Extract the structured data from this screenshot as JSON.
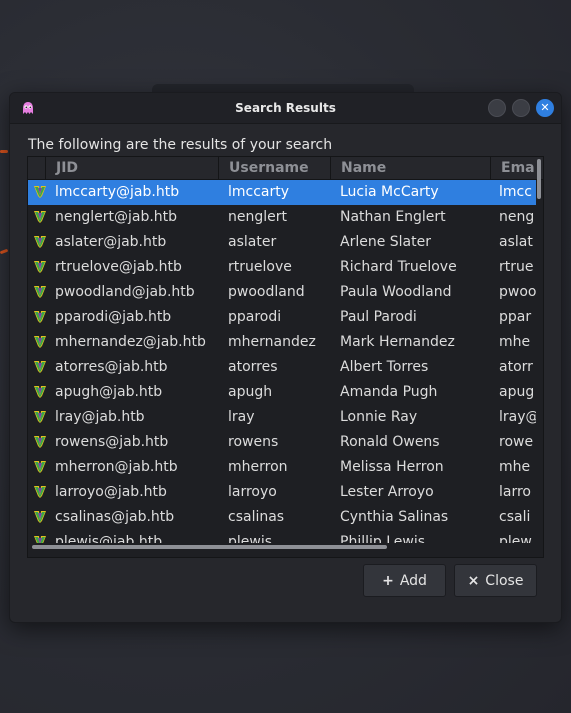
{
  "dialog": {
    "title": "Search Results",
    "description": "The following are the results of your search",
    "close_glyph": "✕"
  },
  "table": {
    "columns": [
      "JID",
      "Username",
      "Name",
      "Ema"
    ],
    "rows": [
      {
        "jid": "lmccarty@jab.htb",
        "username": "lmccarty",
        "name": "Lucia McCarty",
        "email": "lmcc"
      },
      {
        "jid": "nenglert@jab.htb",
        "username": "nenglert",
        "name": "Nathan Englert",
        "email": "neng"
      },
      {
        "jid": "aslater@jab.htb",
        "username": "aslater",
        "name": "Arlene Slater",
        "email": "aslat"
      },
      {
        "jid": "rtruelove@jab.htb",
        "username": "rtruelove",
        "name": "Richard Truelove",
        "email": "rtrue"
      },
      {
        "jid": "pwoodland@jab.htb",
        "username": "pwoodland",
        "name": "Paula Woodland",
        "email": "pwoo"
      },
      {
        "jid": "pparodi@jab.htb",
        "username": "pparodi",
        "name": "Paul Parodi",
        "email": "ppar"
      },
      {
        "jid": "mhernandez@jab.htb",
        "username": "mhernandez",
        "name": "Mark Hernandez",
        "email": "mhe"
      },
      {
        "jid": "atorres@jab.htb",
        "username": "atorres",
        "name": "Albert Torres",
        "email": "atorr"
      },
      {
        "jid": "apugh@jab.htb",
        "username": "apugh",
        "name": "Amanda Pugh",
        "email": "apug"
      },
      {
        "jid": "lray@jab.htb",
        "username": "lray",
        "name": "Lonnie Ray",
        "email": "lray@"
      },
      {
        "jid": "rowens@jab.htb",
        "username": "rowens",
        "name": "Ronald Owens",
        "email": "rowe"
      },
      {
        "jid": "mherron@jab.htb",
        "username": "mherron",
        "name": "Melissa Herron",
        "email": "mhe"
      },
      {
        "jid": "larroyo@jab.htb",
        "username": "larroyo",
        "name": "Lester Arroyo",
        "email": "larro"
      },
      {
        "jid": "csalinas@jab.htb",
        "username": "csalinas",
        "name": "Cynthia Salinas",
        "email": "csali"
      },
      {
        "jid": "plewis@jab.htb",
        "username": "plewis",
        "name": "Phillip Lewis",
        "email": "plew"
      }
    ],
    "selected_index": 0,
    "row_icon": "user-contact-icon"
  },
  "buttons": {
    "add_label": "Add",
    "add_icon": "+",
    "close_label": "Close",
    "close_icon": "×"
  },
  "colors": {
    "accent": "#2f7fe0",
    "background": "#26272c"
  }
}
